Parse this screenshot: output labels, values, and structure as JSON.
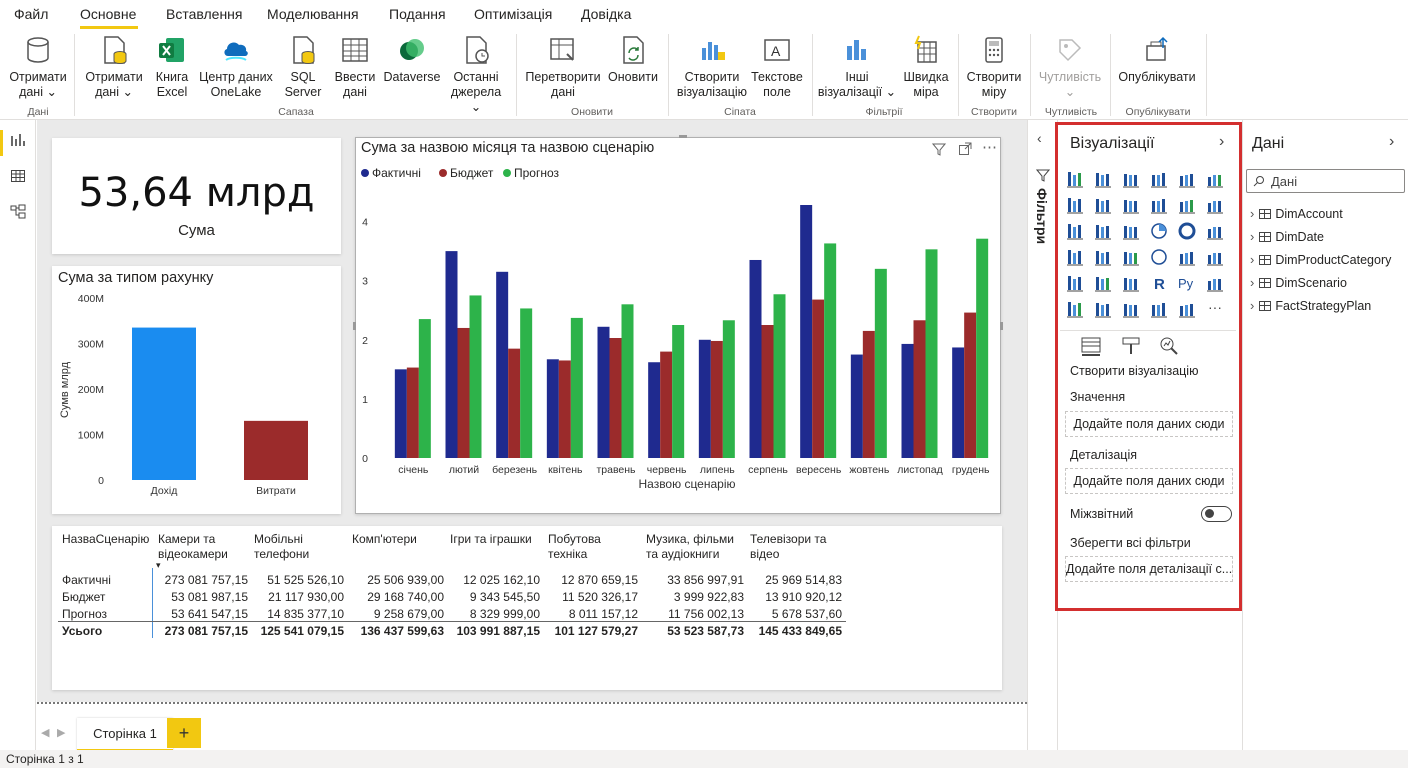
{
  "menu": [
    "Файл",
    "Основне",
    "Вставлення",
    "Моделювання",
    "Подання",
    "Оптимізація",
    "Довідка"
  ],
  "ribbon": {
    "buttons": [
      {
        "l1": "Отримати",
        "l2": "дані ⌄"
      },
      {
        "l1": "Отримати",
        "l2": "дані ⌄"
      },
      {
        "l1": "Книга",
        "l2": "Excel"
      },
      {
        "l1": "Центр даних",
        "l2": "OneLake"
      },
      {
        "l1": "SQL",
        "l2": "Server"
      },
      {
        "l1": "Ввести",
        "l2": "дані"
      },
      {
        "l1": "Dataverse",
        "l2": ""
      },
      {
        "l1": "Останні",
        "l2": "джерела ⌄"
      },
      {
        "l1": "Перетворити",
        "l2": "дані"
      },
      {
        "l1": "Оновити",
        "l2": ""
      },
      {
        "l1": "Створити",
        "l2": "візуалізацію"
      },
      {
        "l1": "Текстове",
        "l2": "поле"
      },
      {
        "l1": "Інші",
        "l2": "візуалізації ⌄"
      },
      {
        "l1": "Швидка",
        "l2": "міра"
      },
      {
        "l1": "Створити",
        "l2": "міру"
      },
      {
        "l1": "Чутливість",
        "l2": "⌄"
      },
      {
        "l1": "Опублікувати",
        "l2": ""
      }
    ],
    "groups": [
      "Дані",
      "Сапаза",
      "Оновити",
      "Сіпата",
      "Фільтрії",
      "Створити",
      "Чутливість",
      "Опублікувати"
    ]
  },
  "kpi": {
    "value": "53,64 млрд",
    "label": "Сума"
  },
  "bar_small": {
    "title": "Сума за типом рахунку",
    "ylabel": "Сумв млрд",
    "ticks": [
      "400M",
      "300M",
      "200M",
      "100M",
      "0"
    ],
    "chart_data": {
      "type": "bar",
      "categories": [
        "Дохід",
        "Витрати"
      ],
      "values": [
        335,
        130
      ],
      "ylim": [
        0,
        400
      ]
    }
  },
  "main_chart": {
    "title": "Сума за назвою місяця та назвою сценарію",
    "xlabel": "Назвою сценарію",
    "legend": [
      "Фактичні",
      "Бюджет",
      "Прогноз"
    ],
    "yticks": [
      "4",
      "3",
      "2",
      "1",
      "0"
    ],
    "colors": [
      "#1f2a8f",
      "#9b2b2b",
      "#2db34a"
    ],
    "chart_data": {
      "type": "bar",
      "categories": [
        "січень",
        "лютий",
        "березень",
        "квітень",
        "травень",
        "червень",
        "липень",
        "серпень",
        "вересень",
        "жовтень",
        "листопад",
        "грудень"
      ],
      "series": [
        {
          "name": "Фактичні",
          "values": [
            1.5,
            3.5,
            3.15,
            1.67,
            2.22,
            1.62,
            2.0,
            3.35,
            4.28,
            1.75,
            1.93,
            1.87
          ]
        },
        {
          "name": "Бюджет",
          "values": [
            1.53,
            2.2,
            1.85,
            1.65,
            2.03,
            1.8,
            1.98,
            2.25,
            2.68,
            2.15,
            2.33,
            2.46
          ]
        },
        {
          "name": "Прогноз",
          "values": [
            2.35,
            2.75,
            2.53,
            2.37,
            2.6,
            2.25,
            2.33,
            2.77,
            3.63,
            3.2,
            3.53,
            3.71
          ]
        }
      ],
      "ylim": [
        0,
        4.5
      ]
    }
  },
  "table": {
    "headers": [
      "НазваСценарію",
      "Камери та\nвідеокамери",
      "Мобільні\nтелефони",
      "Комп'ютери",
      "Ігри та іграшки",
      "Побутова\nтехніка",
      "Музика, фільми\nта аудіокниги",
      "Телевізори та\nвідео"
    ],
    "rows": [
      [
        "Фактичні",
        "273 081 757,15",
        "51 525 526,10",
        "25 506 939,00",
        "12 025 162,10",
        "12 870 659,15",
        "33 856 997,91",
        "25 969 514,83"
      ],
      [
        "Бюджет",
        "53 081 987,15",
        "21 117 930,00",
        "29 168 740,00",
        "9 343 545,50",
        "11 520 326,17",
        "3 999 922,83",
        "13 910 920,12"
      ],
      [
        "Прогноз",
        "53 641 547,15",
        "14 835 377,10",
        "9 258 679,00",
        "8 329 999,00",
        "8 011 157,12",
        "11 756 002,13",
        "5 678 537,60"
      ],
      [
        "Усього",
        "273 081 757,15",
        "125 541 079,15",
        "136 437 599,63",
        "103 991 887,15",
        "101 127 579,27",
        "53 523 587,73",
        "145 433 849,65"
      ]
    ]
  },
  "tabs": {
    "page": "Сторінка 1",
    "add": "+"
  },
  "status": "Сторінка 1 з 1",
  "filters_label": "Фільтри",
  "viz": {
    "title": "Візуалізації",
    "build": "Створити візуалізацію",
    "wells": [
      {
        "label": "Значення",
        "btn": "Додайте поля даних сюди"
      },
      {
        "label": "Деталізація",
        "btn": "Додайте поля даних сюди"
      }
    ],
    "crossreport": "Міжзвітний",
    "keep": "Зберегти всі фільтри",
    "keep_btn": "Додайте поля деталізації с..."
  },
  "data": {
    "title": "Дані",
    "search_placeholder": "Дані",
    "tables": [
      "DimAccount",
      "DimDate",
      "DimProductCategory",
      "DimScenario",
      "FactStrategyPlan"
    ]
  }
}
